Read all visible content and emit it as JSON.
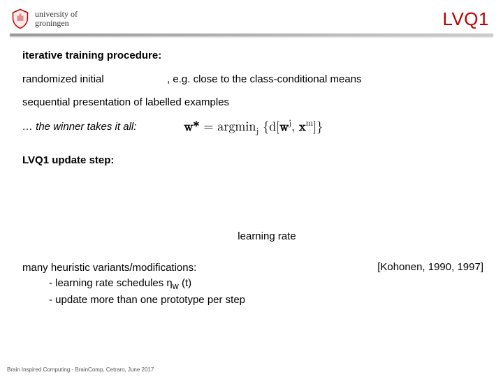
{
  "header": {
    "university_line1": "university of",
    "university_line2": "groningen",
    "title": "LVQ1"
  },
  "content": {
    "heading": "iterative training procedure:",
    "line1_a": "randomized initial",
    "line1_b": ", e.g. close to the class-conditional means",
    "line2_a": "sequential presentation of ",
    "line2_b": "labelled",
    "line2_c": " examples",
    "winner": "… the winner takes it all:",
    "formula_lhs": "w*",
    "formula_eq": " = argmin",
    "formula_sub": "j",
    "formula_open": " {d[",
    "formula_w": "w",
    "formula_w_sup": "j",
    "formula_comma": ", ",
    "formula_x": "x",
    "formula_x_sup": "m",
    "formula_close": "]}",
    "update_heading": "LVQ1 update step:",
    "lr_label": "learning rate",
    "variants_main": "many heuristic variants/modifications:",
    "variants_sub1_a": "- learning rate schedules η",
    "variants_sub1_b": "w",
    "variants_sub1_c": " (t)",
    "variants_sub2": "- update more than one prototype per step",
    "reference": "[Kohonen, 1990, 1997]"
  },
  "footer": {
    "text": "Brain Inspired Computing - BrainComp, Cetraro, June 2017"
  }
}
